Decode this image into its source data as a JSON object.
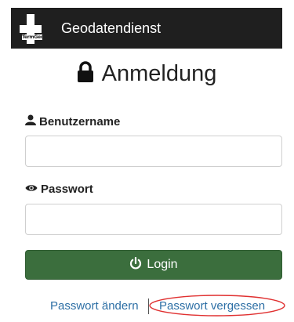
{
  "app": {
    "brand": "Geodatendienst",
    "logo_text": "TermGeo"
  },
  "login": {
    "title": "Anmeldung",
    "username_label": "Benutzername",
    "username_value": "",
    "password_label": "Passwort",
    "password_value": "",
    "login_button": "Login"
  },
  "links": {
    "change_password": "Passwort ändern",
    "forgot_password": "Passwort vergessen"
  },
  "colors": {
    "navbar": "#1f1f1f",
    "login_button": "#3b6e3d",
    "link": "#2d6fa5",
    "annotation": "#e03030"
  },
  "icons": {
    "title": "lock-icon",
    "username": "user-icon",
    "password": "eye-icon",
    "login": "power-icon"
  }
}
